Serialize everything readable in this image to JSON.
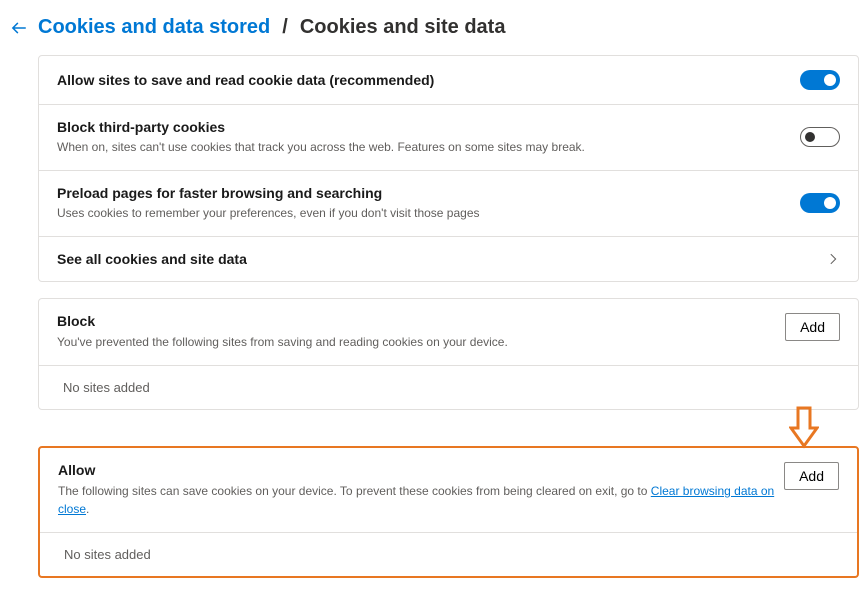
{
  "breadcrumb": {
    "back_label": "Back",
    "link": "Cookies and data stored",
    "separator": "/",
    "current": "Cookies and site data"
  },
  "settings": {
    "allow_cookies": {
      "title": "Allow sites to save and read cookie data (recommended)"
    },
    "block_third_party": {
      "title": "Block third-party cookies",
      "subtitle": "When on, sites can't use cookies that track you across the web. Features on some sites may break."
    },
    "preload": {
      "title": "Preload pages for faster browsing and searching",
      "subtitle": "Uses cookies to remember your preferences, even if you don't visit those pages"
    },
    "see_all": {
      "title": "See all cookies and site data"
    }
  },
  "block_section": {
    "title": "Block",
    "desc": "You've prevented the following sites from saving and reading cookies on your device.",
    "add_label": "Add",
    "empty": "No sites added"
  },
  "allow_section": {
    "title": "Allow",
    "desc_prefix": "The following sites can save cookies on your device. To prevent these cookies from being cleared on exit, go to ",
    "desc_link": "Clear browsing data on close",
    "desc_suffix": ".",
    "add_label": "Add",
    "empty": "No sites added"
  }
}
